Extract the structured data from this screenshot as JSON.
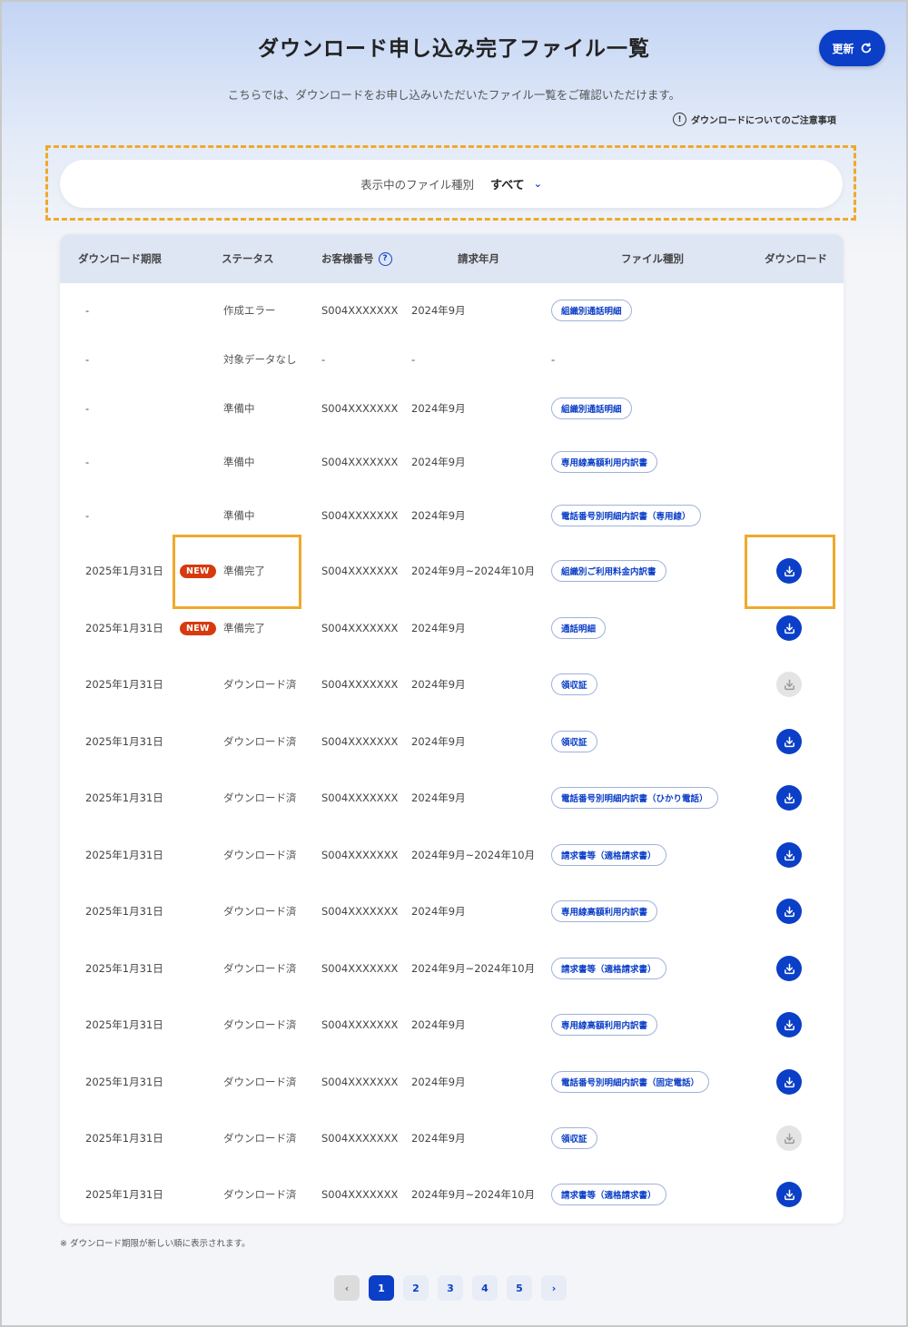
{
  "header": {
    "title": "ダウンロード申し込み完了ファイル一覧",
    "refresh_label": "更新",
    "subtitle": "こちらでは、ダウンロードをお申し込みいただいたファイル一覧をご確認いただけます。",
    "notice_link": "ダウンロードについてのご注意事項",
    "notice_icon": "!"
  },
  "filter": {
    "label": "表示中のファイル種別",
    "value": "すべて"
  },
  "table": {
    "columns": [
      "ダウンロード期限",
      "ステータス",
      "お客様番号",
      "請求年月",
      "ファイル種別",
      "ダウンロード"
    ],
    "help_icon": "?",
    "rows": [
      {
        "date": "-",
        "new": "",
        "status": "作成エラー",
        "customer": "S004XXXXXXX",
        "month": "2024年9月",
        "type": "組織別通話明細",
        "download": "none"
      },
      {
        "date": "-",
        "new": "",
        "status": "対象データなし",
        "customer": "-",
        "month": "-",
        "type": "-",
        "download": "none"
      },
      {
        "date": "-",
        "new": "",
        "status": "準備中",
        "customer": "S004XXXXXXX",
        "month": "2024年9月",
        "type": "組織別通話明細",
        "download": "none"
      },
      {
        "date": "-",
        "new": "",
        "status": "準備中",
        "customer": "S004XXXXXXX",
        "month": "2024年9月",
        "type": "専用線高額利用内訳書",
        "download": "none"
      },
      {
        "date": "-",
        "new": "",
        "status": "準備中",
        "customer": "S004XXXXXXX",
        "month": "2024年9月",
        "type": "電話番号別明細内訳書（専用線）",
        "download": "none"
      },
      {
        "date": "2025年1月31日",
        "new": "NEW",
        "status": "準備完了",
        "customer": "S004XXXXXXX",
        "month": "2024年9月~2024年10月",
        "type": "組織別ご利用料金内訳書",
        "download": "active"
      },
      {
        "date": "2025年1月31日",
        "new": "NEW",
        "status": "準備完了",
        "customer": "S004XXXXXXX",
        "month": "2024年9月",
        "type": "通話明細",
        "download": "active"
      },
      {
        "date": "2025年1月31日",
        "new": "",
        "status": "ダウンロード済",
        "customer": "S004XXXXXXX",
        "month": "2024年9月",
        "type": "領収証",
        "download": "done"
      },
      {
        "date": "2025年1月31日",
        "new": "",
        "status": "ダウンロード済",
        "customer": "S004XXXXXXX",
        "month": "2024年9月",
        "type": "領収証",
        "download": "active"
      },
      {
        "date": "2025年1月31日",
        "new": "",
        "status": "ダウンロード済",
        "customer": "S004XXXXXXX",
        "month": "2024年9月",
        "type": "電話番号別明細内訳書（ひかり電話）",
        "download": "active"
      },
      {
        "date": "2025年1月31日",
        "new": "",
        "status": "ダウンロード済",
        "customer": "S004XXXXXXX",
        "month": "2024年9月~2024年10月",
        "type": "請求書等（適格請求書）",
        "download": "active"
      },
      {
        "date": "2025年1月31日",
        "new": "",
        "status": "ダウンロード済",
        "customer": "S004XXXXXXX",
        "month": "2024年9月",
        "type": "専用線高額利用内訳書",
        "download": "active"
      },
      {
        "date": "2025年1月31日",
        "new": "",
        "status": "ダウンロード済",
        "customer": "S004XXXXXXX",
        "month": "2024年9月~2024年10月",
        "type": "請求書等（適格請求書）",
        "download": "active"
      },
      {
        "date": "2025年1月31日",
        "new": "",
        "status": "ダウンロード済",
        "customer": "S004XXXXXXX",
        "month": "2024年9月",
        "type": "専用線高額利用内訳書",
        "download": "active"
      },
      {
        "date": "2025年1月31日",
        "new": "",
        "status": "ダウンロード済",
        "customer": "S004XXXXXXX",
        "month": "2024年9月",
        "type": "電話番号別明細内訳書（固定電話）",
        "download": "active"
      },
      {
        "date": "2025年1月31日",
        "new": "",
        "status": "ダウンロード済",
        "customer": "S004XXXXXXX",
        "month": "2024年9月",
        "type": "領収証",
        "download": "done"
      },
      {
        "date": "2025年1月31日",
        "new": "",
        "status": "ダウンロード済",
        "customer": "S004XXXXXXX",
        "month": "2024年9月~2024年10月",
        "type": "請求書等（適格請求書）",
        "download": "active"
      }
    ]
  },
  "footnote": "※ ダウンロード期限が新しい順に表示されます。",
  "pagination": {
    "prev": "‹",
    "pages": [
      "1",
      "2",
      "3",
      "4",
      "5"
    ],
    "current": "1",
    "next": "›"
  },
  "colors": {
    "accent": "#0b3fc7",
    "new_badge": "#d63a0f",
    "highlight": "#f0a92b"
  }
}
